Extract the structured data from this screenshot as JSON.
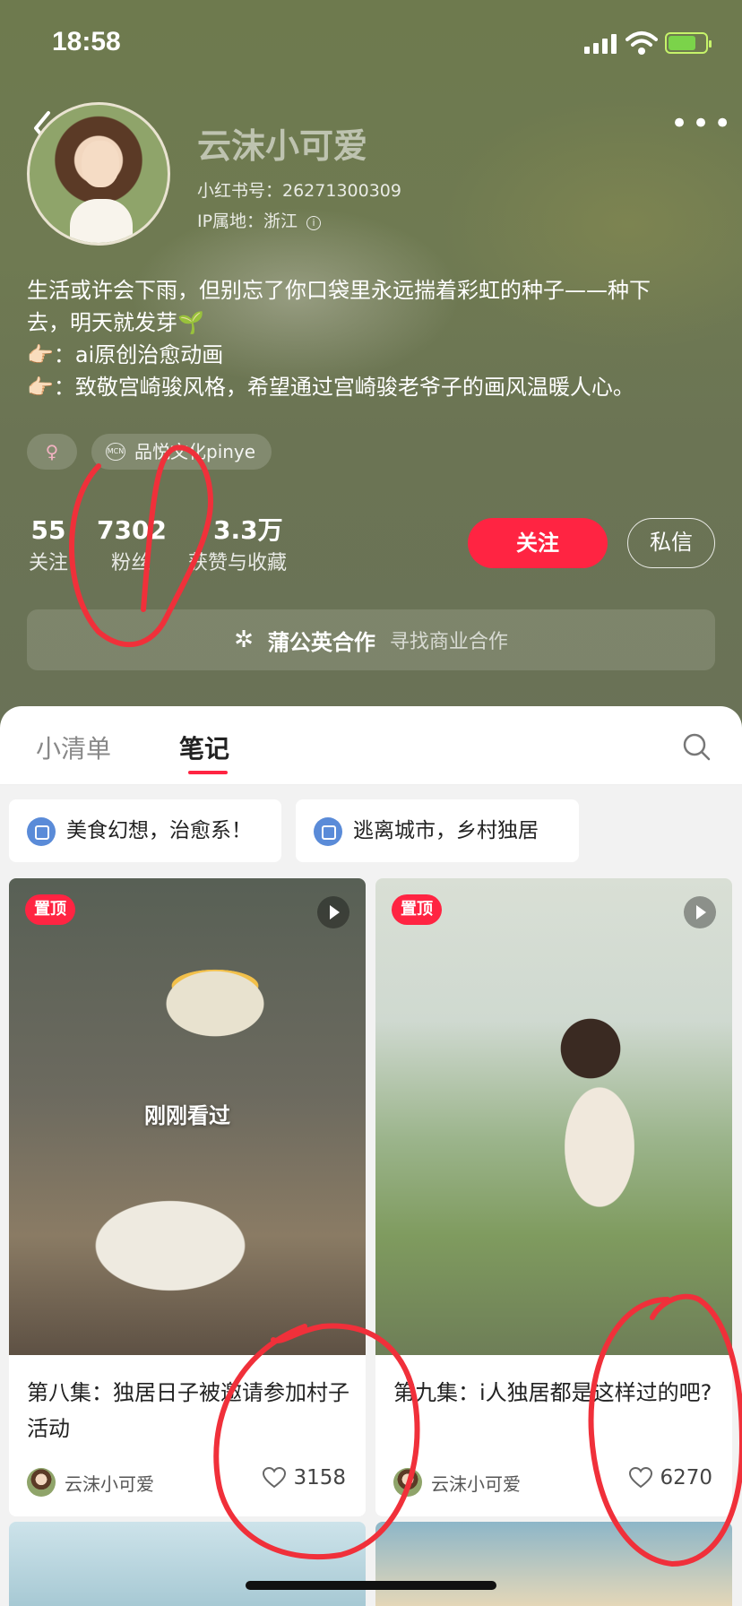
{
  "status_bar": {
    "time": "18:58"
  },
  "profile": {
    "name": "云沫小可爱",
    "red_id": "小红书号：26271300309",
    "ip_location": "IP属地：浙江",
    "bio": [
      "生活或许会下雨，但别忘了你口袋里永远揣着彩虹的种子——种下",
      "去，明天就发芽🌱",
      "👉🏻：ai原创治愈动画",
      "👉🏻：致敬宫崎骏风格，希望通过宫崎骏老爷子的画风温暖人心。"
    ],
    "tags": {
      "gender": "♀",
      "org_logo": "MCN",
      "org": "品悦文化pinye"
    },
    "stats": {
      "following": {
        "value": "55",
        "label": "关注"
      },
      "followers": {
        "value": "7302",
        "label": "粉丝"
      },
      "likes": {
        "value": "3.3万",
        "label": "获赞与收藏"
      }
    },
    "buttons": {
      "follow": "关注",
      "message": "私信"
    },
    "cooperation": {
      "title": "蒲公英合作",
      "subtitle": "寻找商业合作"
    }
  },
  "tabs": [
    {
      "label": "小清单",
      "active": false
    },
    {
      "label": "笔记",
      "active": true
    }
  ],
  "collections": [
    {
      "label": "美食幻想，治愈系！"
    },
    {
      "label": "逃离城市，乡村独居"
    }
  ],
  "notes": [
    {
      "badge": "置顶",
      "overlay": "刚刚看过",
      "title": "第八集：独居日子被邀请参加村子活动",
      "author": "云沫小可爱",
      "likes": "3158"
    },
    {
      "badge": "置顶",
      "overlay": "",
      "title": "第九集：i人独居都是这样过的吧?",
      "author": "云沫小可爱",
      "likes": "6270"
    }
  ],
  "colors": {
    "accent": "#ff2442",
    "annotation": "#f0303a"
  },
  "icons": [
    "back-arrow-icon",
    "more-icon",
    "info-icon",
    "dandelion-icon",
    "search-icon",
    "collection-icon",
    "play-icon",
    "heart-icon"
  ]
}
